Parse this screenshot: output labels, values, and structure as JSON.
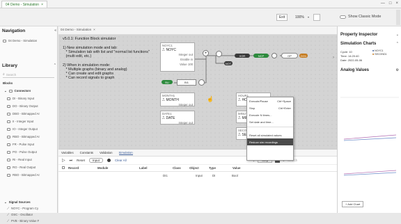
{
  "window": {
    "tab_title": "04 Demo - Simulation",
    "tab_close": "×",
    "controls": [
      "—",
      "□",
      "×"
    ]
  },
  "toolbar": {
    "exit_label": "Exit",
    "zoom_label": "100%",
    "show_classic_label": "Show Classic Mode"
  },
  "nav": {
    "title": "Navigation",
    "collapse": "«",
    "item": "04 Demo - Simulation"
  },
  "library": {
    "title": "Library",
    "search_placeholder": "Search",
    "blocks_label": "Blocks",
    "connectors_label": "Connectors",
    "items": [
      "DI - Binary Input",
      "DO - Binary Output",
      "DBO - Bitmapped Ar",
      "II - Integer Input",
      "IO - Integer Output",
      "RBO - Bitmapped Ar",
      "FR - Pulse Input",
      "PO - Pulse Output",
      "RI - Real Input",
      "RO - Real Output",
      "RBO - Bitmapped Ar"
    ],
    "signal_label": "Signal Sources",
    "signals": [
      "NOYC - Program Cy",
      "OSC - Oscillator",
      "PVB - Binary Value F"
    ]
  },
  "doc": {
    "tab": "04 Demo - Simulation",
    "tab_close": "×"
  },
  "notes": {
    "title": "v5.0.1: Function Block simulator",
    "n1": "1) New simulation mode and tab:\n   * Simulation tab with list and \"normal list functions\"\n   (multi edit, etc.)",
    "n2": "2) When in simulation mode:\n   * Multiple graphs (binary and analog)\n   * Can create and edit graphs\n   * Can record signals to graph"
  },
  "blocks": {
    "noyc": {
      "head": "NOYC1",
      "value": "NOYC",
      "r1": "Integer out",
      "r2": "Enable in",
      "r3": "Value  100"
    },
    "month": {
      "head": "MONTH1",
      "value": "MONTH",
      "r1": "Integer out"
    },
    "hour": {
      "head": "HOUR1",
      "value": "HOUR",
      "r1": "Integer out"
    },
    "date": {
      "head": "DATE1",
      "value": "DATE",
      "r1": "Integer out"
    },
    "minute": {
      "head": "MINUTE1",
      "value": "MIN"
    },
    "second": {
      "head": "SECOND1",
      "value": "SEC"
    }
  },
  "nodes": {
    "n1": "NOT",
    "n2": "XOR",
    "n3": "NCP",
    "n4": "OP",
    "n5": "BI1",
    "n6": "DO1",
    "n7": "BU"
  },
  "ctx": {
    "items": [
      [
        "Execute/Pause",
        "Ctrl+Space"
      ],
      [
        "Stop",
        "Ctrl+Enter"
      ],
      [
        "Execute N times...",
        ""
      ],
      [
        "Set date and time...",
        ""
      ],
      [
        "Reset all simulated values",
        ""
      ],
      [
        "Reduce sim recordings",
        ""
      ]
    ]
  },
  "bottom": {
    "tabs": [
      "Variables",
      "Constants",
      "Validation",
      "Simulation"
    ],
    "controls": {
      "reset": "Reset",
      "input": "Input",
      "clear": "Clear All",
      "step": "Step",
      "search": "Search"
    },
    "columns": [
      "Record",
      "Module",
      "Label",
      "Class",
      "Object",
      "Type",
      "Value"
    ],
    "row": {
      "label": "DI1",
      "class": "Input",
      "object": "DI",
      "type": "Bool"
    }
  },
  "inspector": {
    "title": "Property Inspector",
    "sim_title": "Simulation Charts",
    "cycle_label": "Cycle:",
    "cycle_value": "10",
    "time_label": "Time:",
    "time_value": "14:20:40",
    "date_label": "Date:",
    "date_value": "2022-05-06",
    "legend": [
      "NOYC1",
      "SECOND1"
    ],
    "analog_title": "Analog Values",
    "add_chart": "+ Add Chart"
  },
  "colors": {
    "green": "#2d8a3d",
    "orange": "#c47a1e",
    "dark": "#3a3a3a",
    "blue": "#3e5f9a"
  }
}
